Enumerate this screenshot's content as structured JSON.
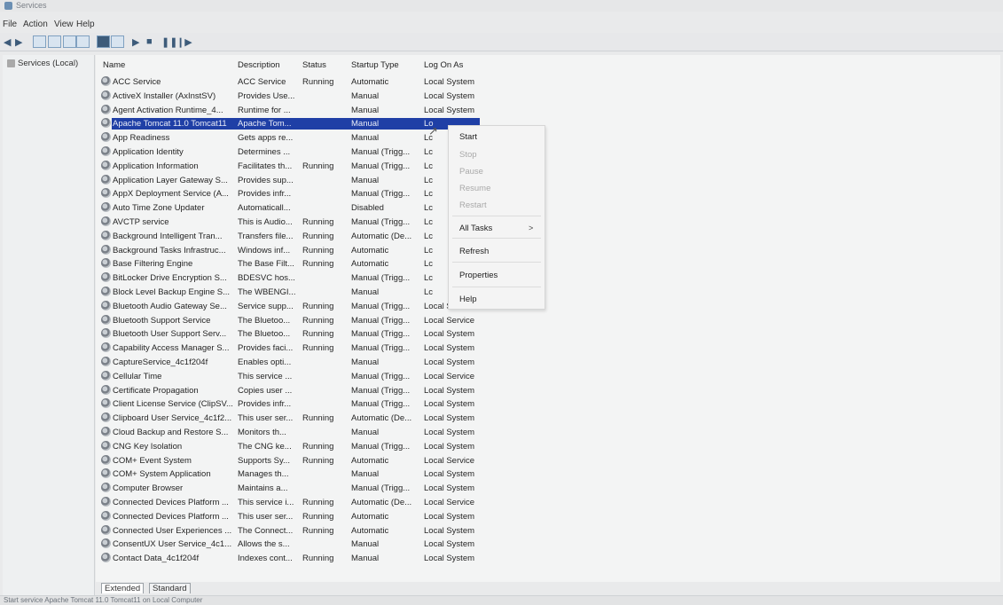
{
  "window": {
    "title": "Services"
  },
  "menu": [
    "File",
    "Action",
    "View",
    "Help"
  ],
  "left_pane": {
    "node": "Services (Local)"
  },
  "columns": [
    "Name",
    "Description",
    "Status",
    "Startup Type",
    "Log On As"
  ],
  "rows": [
    {
      "name": "ACC Service",
      "desc": "ACC Service",
      "status": "Running",
      "startup": "Automatic",
      "logon": "Local System"
    },
    {
      "name": "ActiveX Installer (AxInstSV)",
      "desc": "Provides Use...",
      "status": "",
      "startup": "Manual",
      "logon": "Local System"
    },
    {
      "name": "Agent Activation Runtime_4...",
      "desc": "Runtime for ...",
      "status": "",
      "startup": "Manual",
      "logon": "Local System"
    },
    {
      "name": "Apache Tomcat 11.0 Tomcat11",
      "desc": "Apache Tom...",
      "status": "",
      "startup": "Manual",
      "logon": "Lo"
    },
    {
      "name": "App Readiness",
      "desc": "Gets apps re...",
      "status": "",
      "startup": "Manual",
      "logon": "Lc"
    },
    {
      "name": "Application Identity",
      "desc": "Determines ...",
      "status": "",
      "startup": "Manual (Trigg...",
      "logon": "Lc"
    },
    {
      "name": "Application Information",
      "desc": "Facilitates th...",
      "status": "Running",
      "startup": "Manual (Trigg...",
      "logon": "Lc"
    },
    {
      "name": "Application Layer Gateway S...",
      "desc": "Provides sup...",
      "status": "",
      "startup": "Manual",
      "logon": "Lc"
    },
    {
      "name": "AppX Deployment Service (A...",
      "desc": "Provides infr...",
      "status": "",
      "startup": "Manual (Trigg...",
      "logon": "Lc"
    },
    {
      "name": "Auto Time Zone Updater",
      "desc": "Automaticall...",
      "status": "",
      "startup": "Disabled",
      "logon": "Lc"
    },
    {
      "name": "AVCTP service",
      "desc": "This is Audio...",
      "status": "Running",
      "startup": "Manual (Trigg...",
      "logon": "Lc"
    },
    {
      "name": "Background Intelligent Tran...",
      "desc": "Transfers file...",
      "status": "Running",
      "startup": "Automatic (De...",
      "logon": "Lc"
    },
    {
      "name": "Background Tasks Infrastruc...",
      "desc": "Windows inf...",
      "status": "Running",
      "startup": "Automatic",
      "logon": "Lc"
    },
    {
      "name": "Base Filtering Engine",
      "desc": "The Base Filt...",
      "status": "Running",
      "startup": "Automatic",
      "logon": "Lc"
    },
    {
      "name": "BitLocker Drive Encryption S...",
      "desc": "BDESVC hos...",
      "status": "",
      "startup": "Manual (Trigg...",
      "logon": "Lc"
    },
    {
      "name": "Block Level Backup Engine S...",
      "desc": "The WBENGI...",
      "status": "",
      "startup": "Manual",
      "logon": "Lc"
    },
    {
      "name": "Bluetooth Audio Gateway Se...",
      "desc": "Service supp...",
      "status": "Running",
      "startup": "Manual (Trigg...",
      "logon": "Local Service"
    },
    {
      "name": "Bluetooth Support Service",
      "desc": "The Bluetoo...",
      "status": "Running",
      "startup": "Manual (Trigg...",
      "logon": "Local Service"
    },
    {
      "name": "Bluetooth User Support Serv...",
      "desc": "The Bluetoo...",
      "status": "Running",
      "startup": "Manual (Trigg...",
      "logon": "Local System"
    },
    {
      "name": "Capability Access Manager S...",
      "desc": "Provides faci...",
      "status": "Running",
      "startup": "Manual (Trigg...",
      "logon": "Local System"
    },
    {
      "name": "CaptureService_4c1f204f",
      "desc": "Enables opti...",
      "status": "",
      "startup": "Manual",
      "logon": "Local System"
    },
    {
      "name": "Cellular Time",
      "desc": "This service ...",
      "status": "",
      "startup": "Manual (Trigg...",
      "logon": "Local Service"
    },
    {
      "name": "Certificate Propagation",
      "desc": "Copies user ...",
      "status": "",
      "startup": "Manual (Trigg...",
      "logon": "Local System"
    },
    {
      "name": "Client License Service (ClipSV...",
      "desc": "Provides infr...",
      "status": "",
      "startup": "Manual (Trigg...",
      "logon": "Local System"
    },
    {
      "name": "Clipboard User Service_4c1f2...",
      "desc": "This user ser...",
      "status": "Running",
      "startup": "Automatic (De...",
      "logon": "Local System"
    },
    {
      "name": "Cloud Backup and Restore S...",
      "desc": "Monitors th...",
      "status": "",
      "startup": "Manual",
      "logon": "Local System"
    },
    {
      "name": "CNG Key Isolation",
      "desc": "The CNG ke...",
      "status": "Running",
      "startup": "Manual (Trigg...",
      "logon": "Local System"
    },
    {
      "name": "COM+ Event System",
      "desc": "Supports Sy...",
      "status": "Running",
      "startup": "Automatic",
      "logon": "Local Service"
    },
    {
      "name": "COM+ System Application",
      "desc": "Manages th...",
      "status": "",
      "startup": "Manual",
      "logon": "Local System"
    },
    {
      "name": "Computer Browser",
      "desc": "Maintains a...",
      "status": "",
      "startup": "Manual (Trigg...",
      "logon": "Local System"
    },
    {
      "name": "Connected Devices Platform ...",
      "desc": "This service i...",
      "status": "Running",
      "startup": "Automatic (De...",
      "logon": "Local Service"
    },
    {
      "name": "Connected Devices Platform ...",
      "desc": "This user ser...",
      "status": "Running",
      "startup": "Automatic",
      "logon": "Local System"
    },
    {
      "name": "Connected User Experiences ...",
      "desc": "The Connect...",
      "status": "Running",
      "startup": "Automatic",
      "logon": "Local System"
    },
    {
      "name": "ConsentUX User Service_4c1...",
      "desc": "Allows the s...",
      "status": "",
      "startup": "Manual",
      "logon": "Local System"
    },
    {
      "name": "Contact Data_4c1f204f",
      "desc": "Indexes cont...",
      "status": "Running",
      "startup": "Manual",
      "logon": "Local System"
    }
  ],
  "context_menu": {
    "start": "Start",
    "stop": "Stop",
    "pause": "Pause",
    "resume": "Resume",
    "restart": "Restart",
    "all_tasks": "All Tasks",
    "all_tasks_arrow": ">",
    "refresh": "Refresh",
    "properties": "Properties",
    "help": "Help"
  },
  "tabs": {
    "extended": "Extended",
    "standard": "Standard"
  },
  "statusbar": {
    "text": "Start service Apache Tomcat 11.0 Tomcat11 on Local Computer"
  }
}
